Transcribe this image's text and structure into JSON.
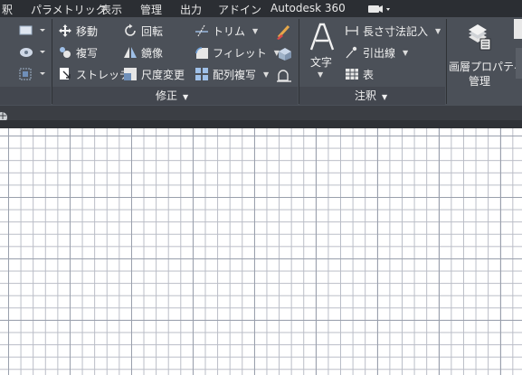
{
  "menu": {
    "items": [
      {
        "label": "釈"
      },
      {
        "label": "パラメトリック"
      },
      {
        "label": "表示"
      },
      {
        "label": "管理"
      },
      {
        "label": "出力"
      },
      {
        "label": "アドイン"
      },
      {
        "label": "Autodesk 360"
      }
    ]
  },
  "ribbon": {
    "modify": {
      "title": "修正",
      "commands": [
        {
          "label": "移動",
          "icon": "move-icon"
        },
        {
          "label": "回転",
          "icon": "rotate-icon"
        },
        {
          "label": "トリム",
          "icon": "trim-icon"
        },
        {
          "label": "複写",
          "icon": "copy-icon"
        },
        {
          "label": "鏡像",
          "icon": "mirror-icon"
        },
        {
          "label": "フィレット",
          "icon": "fillet-icon"
        },
        {
          "label": "ストレッチ",
          "icon": "stretch-icon"
        },
        {
          "label": "尺度変更",
          "icon": "scale-icon"
        },
        {
          "label": "配列複写",
          "icon": "array-icon"
        }
      ]
    },
    "annotation": {
      "title": "注釈",
      "text_label": "文字",
      "commands": [
        {
          "label": "長さ寸法記入",
          "icon": "linear-dimension-icon"
        },
        {
          "label": "引出線",
          "icon": "leader-icon"
        },
        {
          "label": "表",
          "icon": "table-icon"
        }
      ]
    },
    "layers": {
      "label_line1": "画層プロパティ",
      "label_line2": "管理"
    }
  }
}
